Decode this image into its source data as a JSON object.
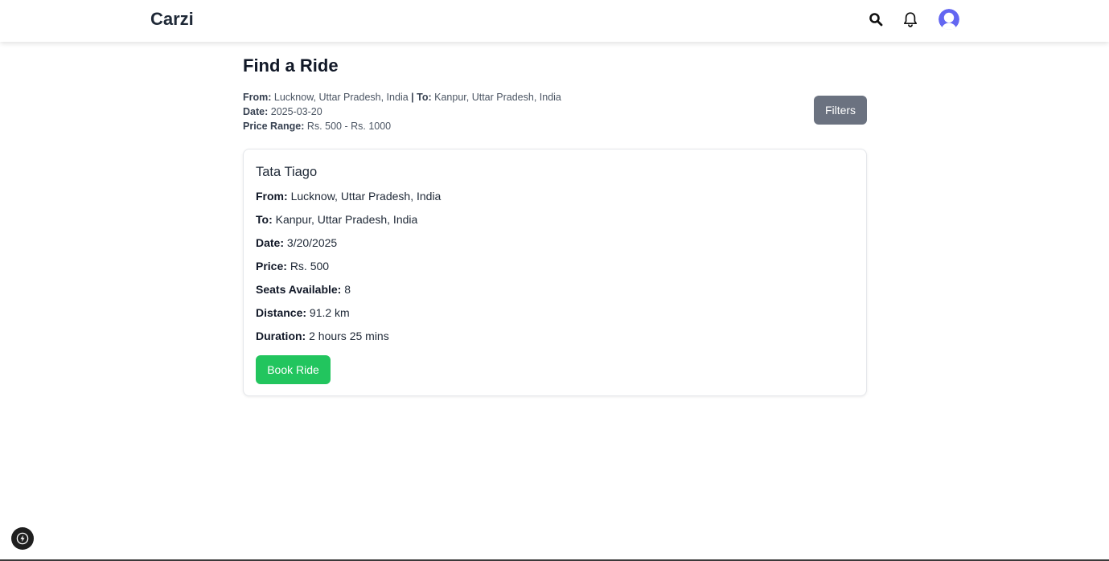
{
  "navbar": {
    "brand": "Carzi",
    "icons": [
      "search-icon",
      "bell-icon",
      "user-avatar-icon"
    ],
    "avatar_color": "#6366f1"
  },
  "page": {
    "title": "Find a Ride"
  },
  "search_summary": {
    "from_label": "From:",
    "from_value": "Lucknow, Uttar Pradesh, India",
    "separator": "|",
    "to_label": "To:",
    "to_value": "Kanpur, Uttar Pradesh, India",
    "date_label": "Date:",
    "date_value": "2025-03-20",
    "price_label": "Price Range:",
    "price_value": "Rs. 500 - Rs. 1000"
  },
  "filters_button": {
    "label": "Filters",
    "color": "#6b7280"
  },
  "rides": [
    {
      "car": "Tata Tiago",
      "from_label": "From:",
      "from": "Lucknow, Uttar Pradesh, India",
      "to_label": "To:",
      "to": "Kanpur, Uttar Pradesh, India",
      "date_label": "Date:",
      "date": "3/20/2025",
      "price_label": "Price:",
      "price": "Rs. 500",
      "seats_label": "Seats Available:",
      "seats": "8",
      "distance_label": "Distance:",
      "distance": "91.2 km",
      "duration_label": "Duration:",
      "duration": "2 hours 25 mins",
      "book_label": "Book Ride",
      "book_color": "#22c55e"
    }
  ],
  "dev_badge": {
    "icon": "lightning-icon"
  }
}
